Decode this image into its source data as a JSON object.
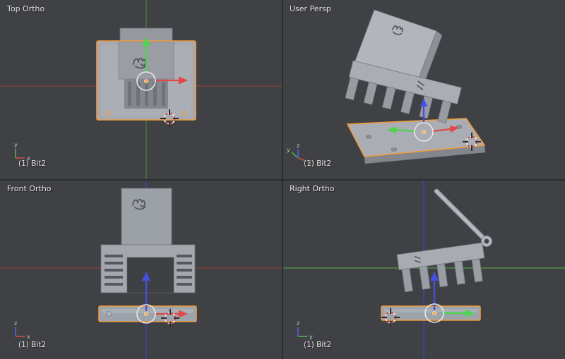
{
  "viewports": {
    "top_left": {
      "label": "Top Ortho",
      "status": "(1) Bit2"
    },
    "top_right": {
      "label": "User Persp",
      "status": "(1) Bit2"
    },
    "bottom_left": {
      "label": "Front Ortho",
      "status": "(1) Bit2"
    },
    "bottom_right": {
      "label": "Right Ortho",
      "status": "(1) Bit2"
    }
  },
  "axis_letters": {
    "x": "x",
    "y": "y",
    "z": "z"
  },
  "colors": {
    "viewport_background": "#404144",
    "separator": "#2b2c2e",
    "selection_outline": "#f09b3c",
    "object_light": "#abaeb5",
    "object_mid": "#9a9da4",
    "object_dark": "#84878e",
    "axis_x_line": "#8a4242",
    "axis_y_line": "#4e7a41",
    "axis_z_line": "#4343b0",
    "manipulator_x": "#e24848",
    "manipulator_y": "#4fd44f",
    "manipulator_z": "#4550e0",
    "cursor_red": "#c94343",
    "origin_orange": "#ffa53f",
    "text": "#e6e6e6"
  }
}
